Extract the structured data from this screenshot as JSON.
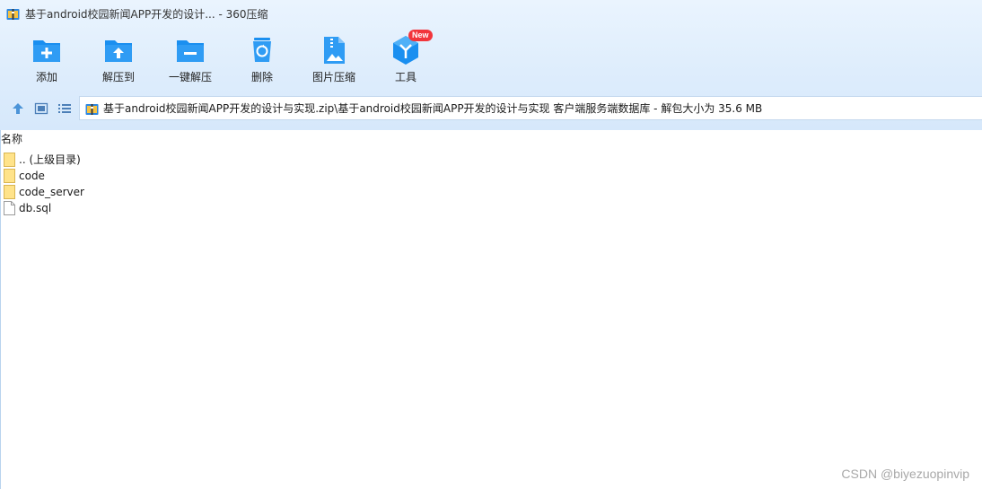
{
  "window": {
    "title": "基于android校园新闻APP开发的设计... - 360压缩"
  },
  "toolbar": {
    "items": [
      {
        "label": "添加",
        "icon": "add-folder-icon"
      },
      {
        "label": "解压到",
        "icon": "extract-to-icon"
      },
      {
        "label": "一键解压",
        "icon": "one-click-extract-icon"
      },
      {
        "label": "删除",
        "icon": "recycle-bin-icon"
      },
      {
        "label": "图片压缩",
        "icon": "image-compress-icon"
      },
      {
        "label": "工具",
        "icon": "tools-cube-icon",
        "badge": "New"
      }
    ]
  },
  "address": {
    "path": "基于android校园新闻APP开发的设计与实现.zip\\基于android校园新闻APP开发的设计与实现 客户端服务端数据库 - 解包大小为 35.6 MB"
  },
  "list": {
    "column_header": "名称",
    "rows": [
      {
        "name": ".. (上级目录)",
        "type": "folder"
      },
      {
        "name": "code",
        "type": "folder"
      },
      {
        "name": "code_server",
        "type": "folder"
      },
      {
        "name": "db.sql",
        "type": "file"
      }
    ]
  },
  "watermark": "CSDN @biyezuopinvip",
  "colors": {
    "accent_blue": "#1a8ff0",
    "badge_red": "#f2353b",
    "folder_yellow": "#ffe38a"
  }
}
